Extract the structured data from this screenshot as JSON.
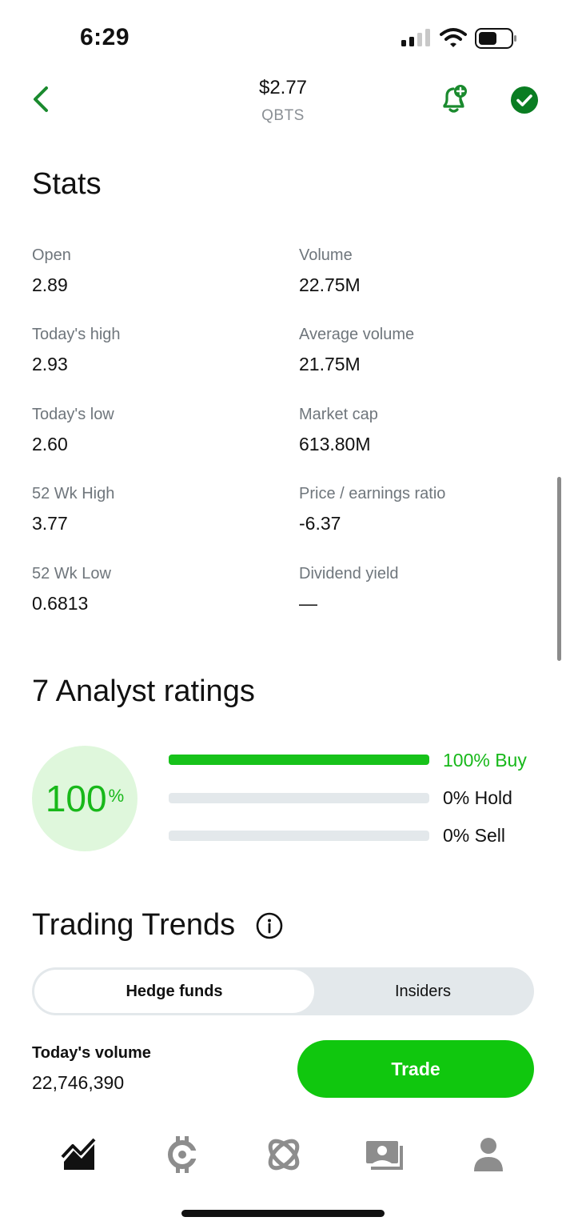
{
  "status_bar": {
    "time": "6:29"
  },
  "header": {
    "price": "$2.77",
    "ticker": "QBTS"
  },
  "stats": {
    "title": "Stats",
    "items": [
      {
        "label": "Open",
        "value": "2.89"
      },
      {
        "label": "Volume",
        "value": "22.75M"
      },
      {
        "label": "Today's high",
        "value": "2.93"
      },
      {
        "label": "Average volume",
        "value": "21.75M"
      },
      {
        "label": "Today's low",
        "value": "2.60"
      },
      {
        "label": "Market cap",
        "value": "613.80M"
      },
      {
        "label": "52 Wk High",
        "value": "3.77"
      },
      {
        "label": "Price / earnings ratio",
        "value": "-6.37"
      },
      {
        "label": "52 Wk Low",
        "value": "0.6813"
      },
      {
        "label": "Dividend yield",
        "value": "—"
      }
    ]
  },
  "analyst": {
    "title": "7 Analyst ratings",
    "circle_value": "100",
    "circle_unit": "%",
    "bars": [
      {
        "label": "100% Buy",
        "fraction": 1.0
      },
      {
        "label": "0% Hold",
        "fraction": 0.0
      },
      {
        "label": "0% Sell",
        "fraction": 0.0
      }
    ]
  },
  "trends": {
    "title": "Trading Trends",
    "tabs": {
      "active": "Hedge funds",
      "inactive": "Insiders"
    }
  },
  "footer": {
    "volume_label": "Today's volume",
    "volume_value": "22,746,390",
    "trade_label": "Trade"
  },
  "bottom_nav": [
    "chart-icon",
    "crypto-icon",
    "browse-icon",
    "cash-icon",
    "account-icon"
  ],
  "colors": {
    "accent_green": "#10c70e",
    "nav_green": "#0a8a1e",
    "light_green": "#dff7dc",
    "track_gray": "#e3e8eb"
  }
}
